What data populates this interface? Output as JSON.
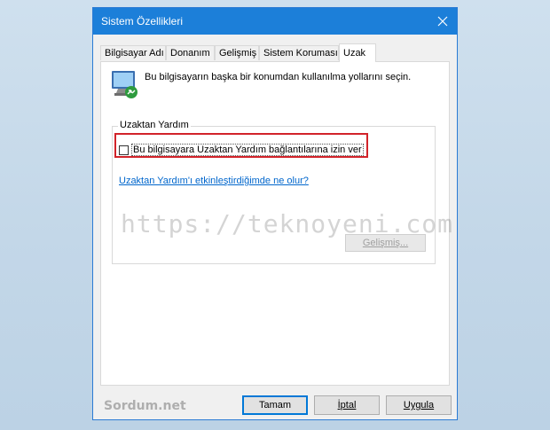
{
  "window": {
    "title": "Sistem Özellikleri",
    "close_symbol": "✕"
  },
  "tabs": [
    {
      "label": "Bilgisayar Adı",
      "active": false
    },
    {
      "label": "Donanım",
      "active": false
    },
    {
      "label": "Gelişmiş",
      "active": false
    },
    {
      "label": "Sistem Koruması",
      "active": false
    },
    {
      "label": "Uzak",
      "active": true
    }
  ],
  "panel": {
    "icon": "computer-remote-icon",
    "intro_text": "Bu bilgisayarın başka bir konumdan kullanılma yollarını seçin.",
    "group_label": "Uzaktan Yardım",
    "checkbox": {
      "label": "Bu bilgisayara Uzaktan Yardım bağlantılarına izin ver",
      "checked": false
    },
    "help_link": "Uzaktan Yardım'ı etkinleştirdiğimde ne olur?",
    "advanced_button": "Gelişmiş..."
  },
  "watermarks": {
    "center": "https://teknoyeni.com",
    "bottom": "Sordum.net"
  },
  "buttons": {
    "ok": "Tamam",
    "cancel": "İptal",
    "apply": "Uygula"
  },
  "colors": {
    "titlebar": "#1c7fd9",
    "highlight": "#d2232a",
    "link": "#0066cc"
  }
}
